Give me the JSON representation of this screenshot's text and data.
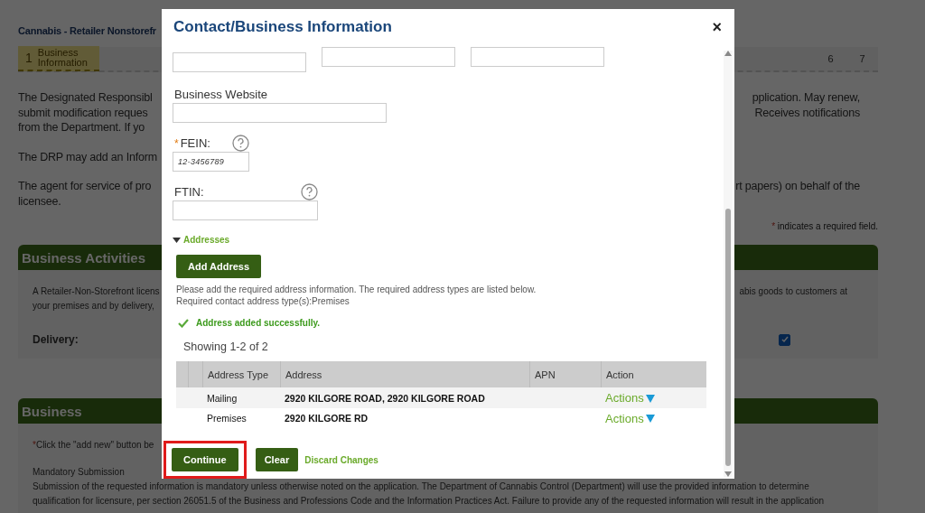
{
  "page": {
    "title": "Cannabis - Retailer Nonstorefr",
    "steps": [
      {
        "number": "1",
        "label": "Business Information",
        "selected": true
      },
      {
        "number": "6",
        "selected": false
      },
      {
        "number": "7",
        "selected": false
      }
    ],
    "intro": [
      {
        "lines": [
          {
            "left": "The Designated Responsibl",
            "right": "pplication. May renew,"
          },
          {
            "left": "submit modification reques",
            "right": "Receives notifications"
          },
          {
            "left": "from the Department. If yo"
          }
        ]
      },
      {
        "lines": [
          {
            "left": "The DRP may add an Inform"
          }
        ]
      },
      {
        "lines": [
          {
            "left": "The agent for service of pro",
            "right": "rt papers) on behalf of the"
          },
          {
            "left": "licensee."
          }
        ]
      }
    ],
    "required_note": {
      "mark": "*",
      "text": "indicates a required field."
    },
    "sections": [
      {
        "title": "Business Activities",
        "paragraphs": [
          {
            "lines": [
              {
                "left": "A Retailer-Non-Storefront licens",
                "right": "abis goods to customers at"
              },
              {
                "left": "your premises and by delivery,"
              }
            ]
          }
        ],
        "checkbox": {
          "label": "Delivery:",
          "checked": true
        }
      },
      {
        "title": "Business",
        "paragraphs": [
          {
            "lines": [
              {
                "mark": "*",
                "left": "Click the \"add new\" button be"
              }
            ]
          },
          {
            "lines": [
              {
                "left": "Mandatory Submission"
              },
              {
                "left": "Submission of the requested information is mandatory unless otherwise noted on the application. The Department of Cannabis Control (Department) will use the provided information to determine"
              },
              {
                "left": "qualification for licensure, per section 26051.5 of the Business and Professions Code and the Information Practices Act. Failure to provide any of the requested information will result in the application"
              }
            ]
          }
        ]
      }
    ]
  },
  "dialog": {
    "title": "Contact/Business Information",
    "close": "×",
    "fields": [
      {
        "label": "Business Website",
        "help": false
      },
      {
        "label": "FEIN:",
        "required_mark": "*",
        "help": true,
        "value": "12-3456789"
      },
      {
        "label": "FTIN:",
        "help": true
      }
    ],
    "addresses": {
      "toggle": "Addresses",
      "expanded": true,
      "add_button": "Add Address",
      "instructions": [
        "Please add the required address information. The required address types are listed below.",
        "Required contact address type(s):Premises"
      ],
      "success": "Address added successfully.",
      "count": "Showing 1-2 of 2",
      "table": {
        "columns": [
          "Address Type",
          "Address",
          "APN",
          "Action"
        ],
        "rows": [
          {
            "type": "Mailing",
            "address": "2920 KILGORE ROAD, 2920 KILGORE ROAD",
            "action": "Actions"
          },
          {
            "type": "Premises",
            "address": "2920 KILGORE RD",
            "action": "Actions"
          }
        ]
      }
    },
    "buttons": [
      {
        "label": "Continue",
        "highlighted": true
      },
      {
        "label": "Clear",
        "highlighted": false
      }
    ],
    "discard_link": "Discard Changes"
  }
}
